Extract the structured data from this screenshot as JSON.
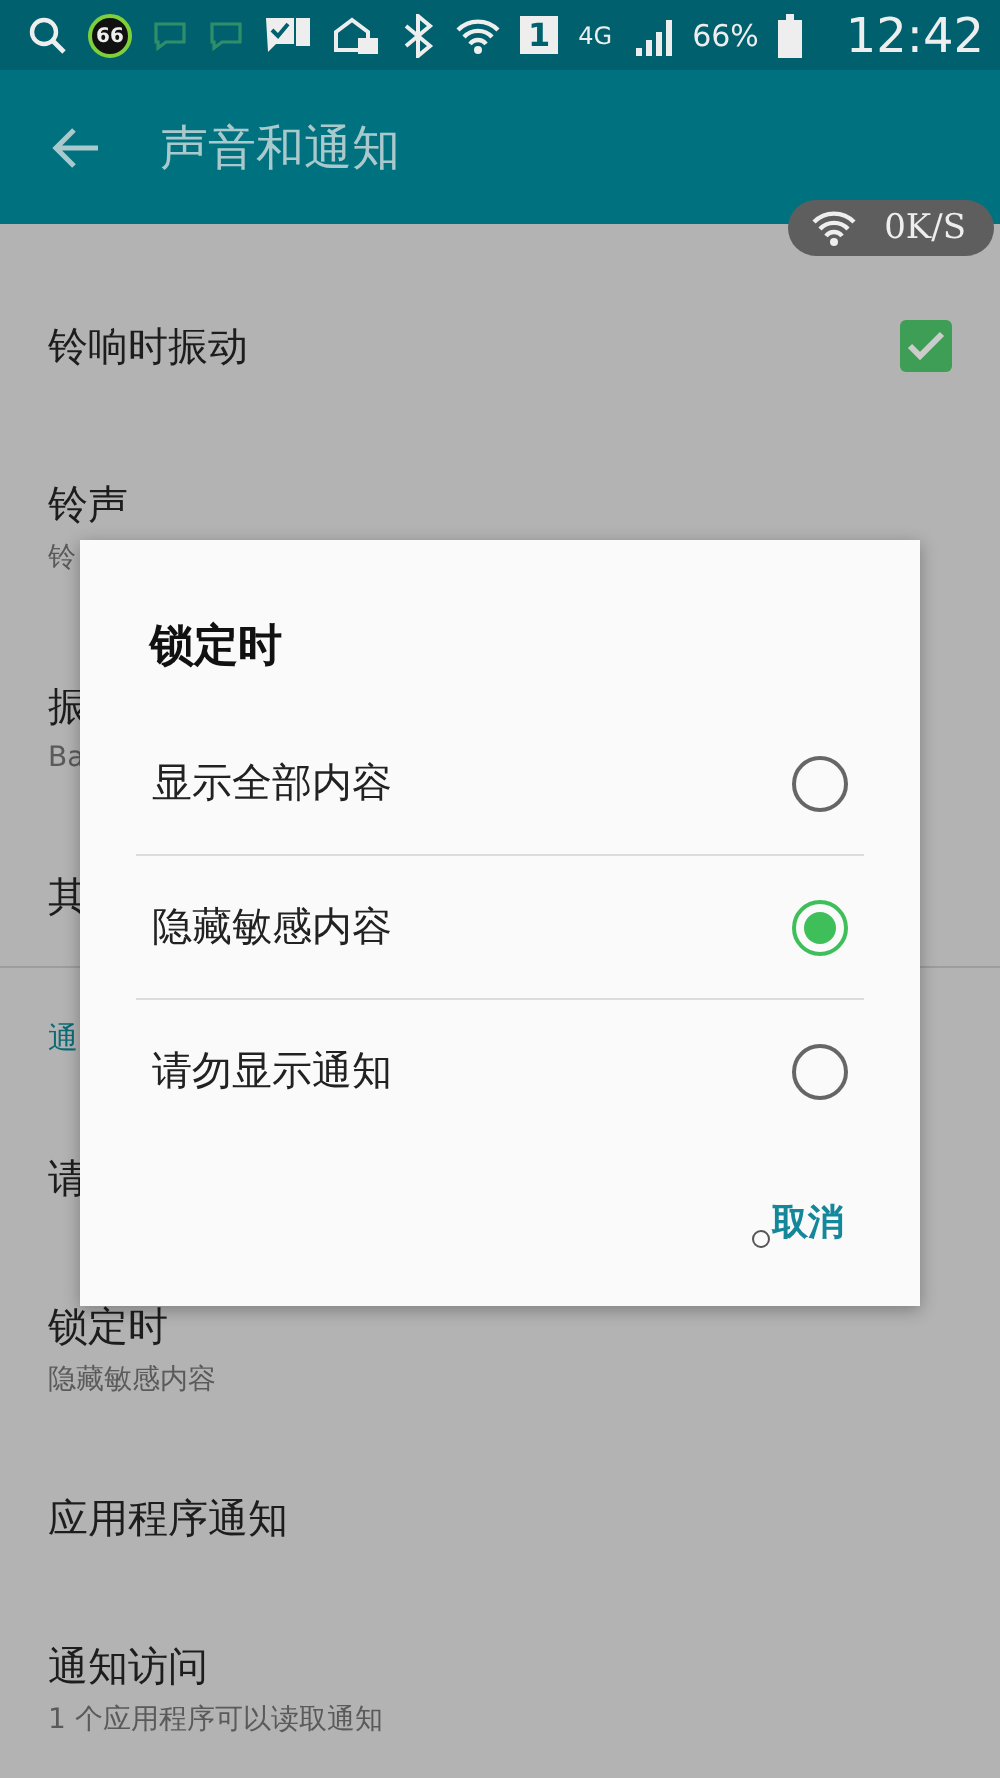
{
  "status_bar": {
    "badge": "66",
    "sim": "1",
    "network": "4G",
    "battery": "66%",
    "time": "12:42"
  },
  "app_bar": {
    "title": "声音和通知"
  },
  "speed_badge": {
    "text": "0K/S"
  },
  "settings": [
    {
      "kind": "toggle",
      "title": "铃响时振动",
      "checked": true
    },
    {
      "kind": "item",
      "title": "铃声",
      "subtitle": "铃"
    },
    {
      "kind": "item",
      "title": "振",
      "subtitle": "Ba"
    },
    {
      "kind": "item",
      "title": "其"
    },
    {
      "kind": "divider"
    },
    {
      "kind": "header",
      "title": "通"
    },
    {
      "kind": "item",
      "title": "请"
    },
    {
      "kind": "item",
      "title": "锁定时",
      "subtitle": "隐藏敏感内容"
    },
    {
      "kind": "item",
      "title": "应用程序通知"
    },
    {
      "kind": "item",
      "title": "通知访问",
      "subtitle": "1 个应用程序可以读取通知"
    }
  ],
  "dialog": {
    "title": "锁定时",
    "options": [
      {
        "label": "显示全部内容",
        "selected": false
      },
      {
        "label": "隐藏敏感内容",
        "selected": true
      },
      {
        "label": "请勿显示通知",
        "selected": false
      }
    ],
    "buttons": [
      "取消"
    ]
  }
}
